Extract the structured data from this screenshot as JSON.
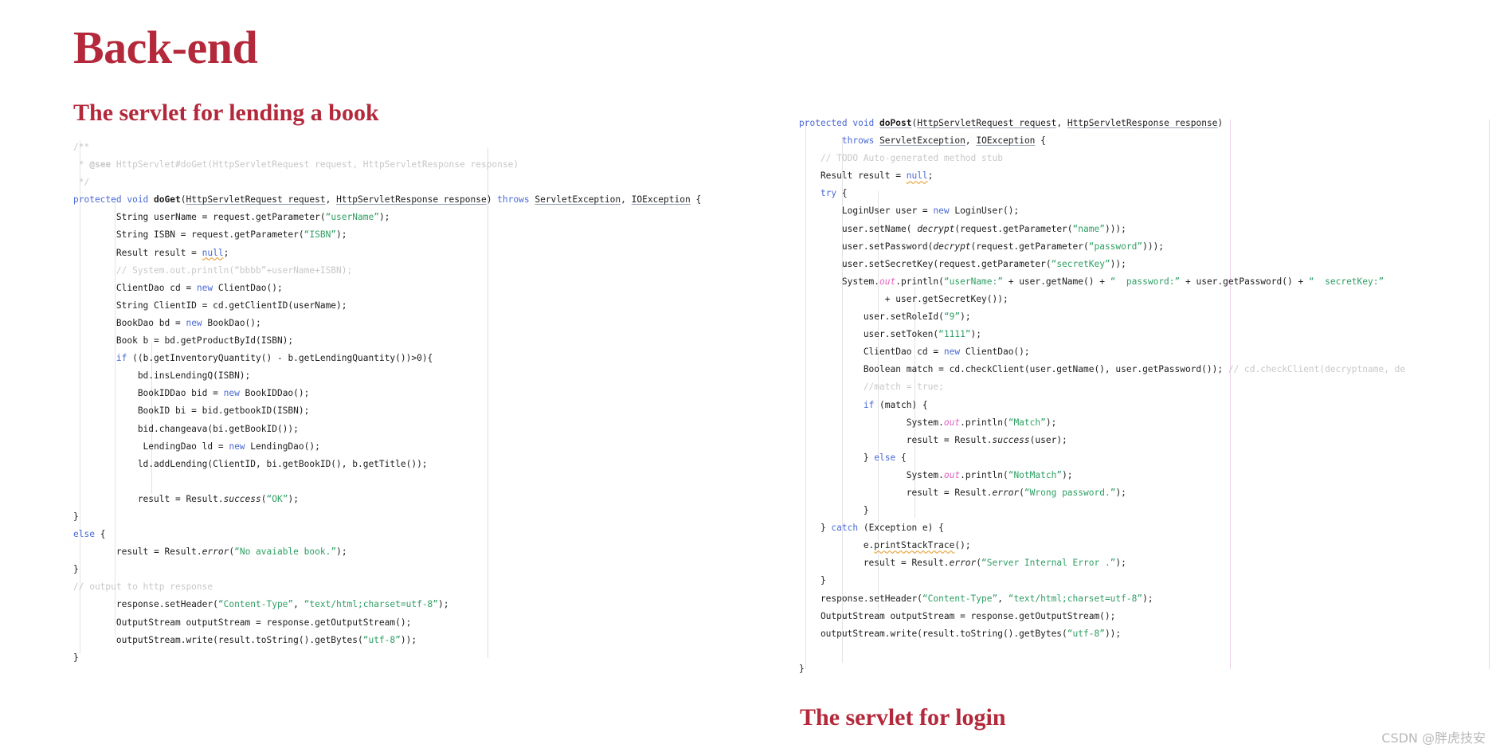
{
  "slide": {
    "title": "Back-end",
    "accent_color": "#b3283a",
    "background": "#ffffff",
    "headings": {
      "left": "The servlet for lending a book",
      "right": "The servlet for login"
    },
    "watermark": "CSDN @胖虎技安"
  },
  "syntax_colors": {
    "keyword": "#4a69d6",
    "string": "#2e9e63",
    "comment": "#c8c8c8",
    "field": "#e060c0",
    "text": "#1c1c1c",
    "ruler": "#ecd4e8",
    "indent_guide": "#e3e3e8"
  },
  "code_left": {
    "language": "java",
    "method": "doGet",
    "lines": [
      "/**",
      " * @see HttpServlet#doGet(HttpServletRequest request, HttpServletResponse response)",
      " */",
      "protected void doGet(HttpServletRequest request, HttpServletResponse response) throws ServletException, IOException {",
      "        String userName = request.getParameter(\"userName\");",
      "        String ISBN = request.getParameter(\"ISBN\");",
      "        Result result = null;",
      "        // System.out.println(\"bbbb\"+userName+ISBN);",
      "        ClientDao cd = new ClientDao();",
      "        String ClientID = cd.getClientID(userName);",
      "        BookDao bd = new BookDao();",
      "        Book b = bd.getProductById(ISBN);",
      "        if ((b.getInventoryQuantity() - b.getLendingQuantity())>0){",
      "            bd.insLendingQ(ISBN);",
      "            BookIDDao bid = new BookIDDao();",
      "            BookID bi = bid.getbookID(ISBN);",
      "            bid.changeava(bi.getBookID());",
      "             LendingDao ld = new LendingDao();",
      "            ld.addLending(ClientID, bi.getBookID(), b.getTitle());",
      "",
      "            result = Result.success(\"OK\");",
      "}",
      "else {",
      "        result = Result.error(\"No avaiable book.\");",
      "}",
      "// output to http response",
      "        response.setHeader(\"Content-Type\", \"text/html;charset=utf-8\");",
      "        OutputStream outputStream = response.getOutputStream();",
      "        outputStream.write(result.toString().getBytes(\"utf-8\"));",
      "}"
    ]
  },
  "code_right": {
    "language": "java",
    "method": "doPost",
    "lines": [
      "protected void doPost(HttpServletRequest request, HttpServletResponse response)",
      "        throws ServletException, IOException {",
      "    // TODO Auto-generated method stub",
      "    Result result = null;",
      "    try {",
      "        LoginUser user = new LoginUser();",
      "        user.setName( decrypt(request.getParameter(\"name\")));",
      "        user.setPassword(decrypt(request.getParameter(\"password\")));",
      "        user.setSecretKey(request.getParameter(\"secretKey\"));",
      "        System.out.println(\"userName:\" + user.getName() + \"  password:\" + user.getPassword() + \"  secretKey:\"",
      "                + user.getSecretKey());",
      "            user.setRoleId(\"9\");",
      "            user.setToken(\"1111\");",
      "            ClientDao cd = new ClientDao();",
      "            Boolean match = cd.checkClient(user.getName(), user.getPassword()); // cd.checkClient(decryptname, de",
      "            //match = true;",
      "            if (match) {",
      "                    System.out.println(\"Match\");",
      "                    result = Result.success(user);",
      "            } else {",
      "                    System.out.println(\"NotMatch\");",
      "                    result = Result.error(\"Wrong password.\");",
      "            }",
      "    } catch (Exception e) {",
      "            e.printStackTrace();",
      "            result = Result.error(\"Server Internal Error .\");",
      "    }",
      "    response.setHeader(\"Content-Type\", \"text/html;charset=utf-8\");",
      "    OutputStream outputStream = response.getOutputStream();",
      "    outputStream.write(result.toString().getBytes(\"utf-8\"));",
      "",
      "}"
    ]
  }
}
